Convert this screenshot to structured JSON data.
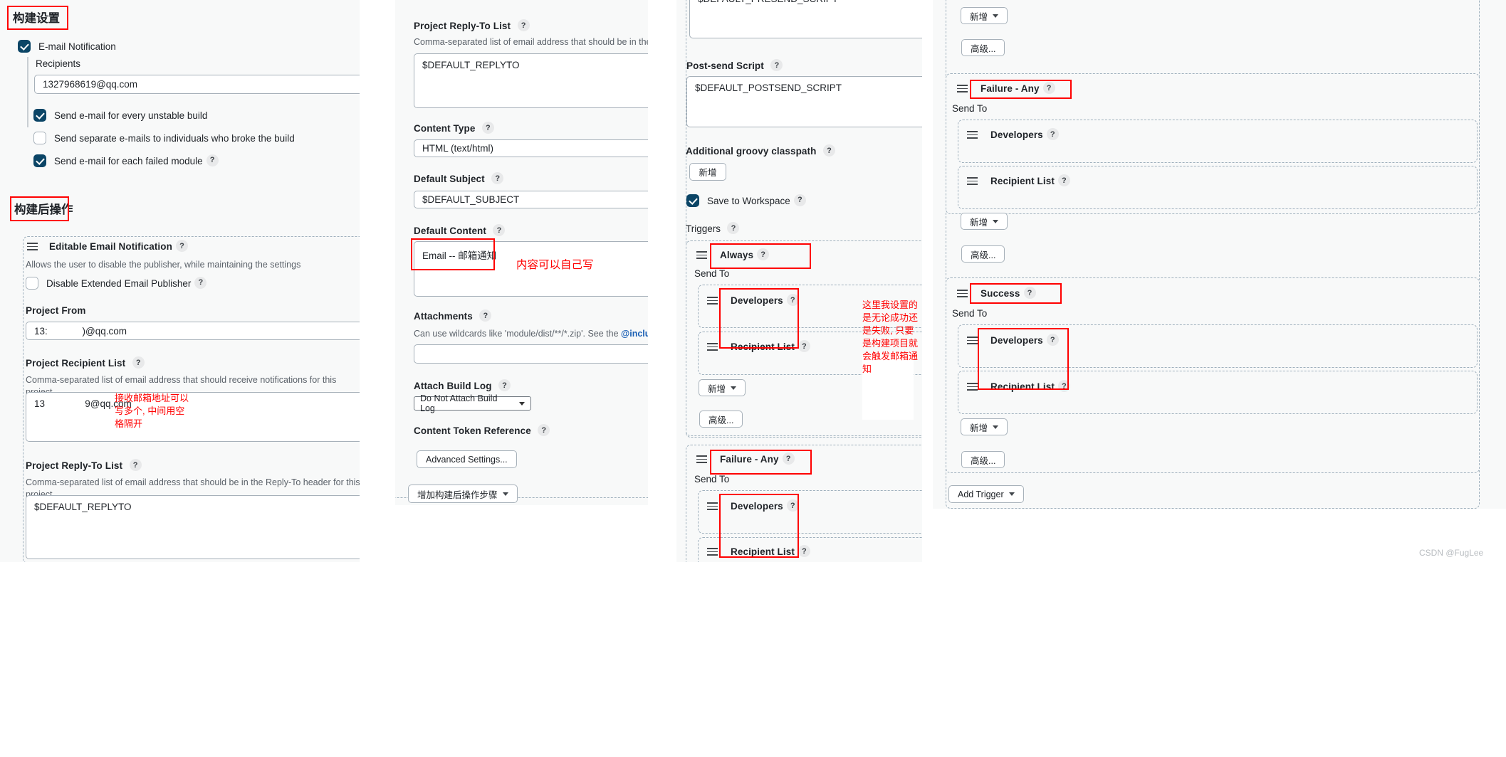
{
  "col1": {
    "section_title_build_settings": "构建设置",
    "email_notification_label": "E-mail Notification",
    "recipients_label": "Recipients",
    "recipients_value": "1327968619@qq.com",
    "checkbox_unstable": "Send e-mail for every unstable build",
    "checkbox_separate": "Send separate e-mails to individuals who broke the build",
    "checkbox_failed_module": "Send e-mail for each failed module",
    "section_title_post_build": "构建后操作",
    "editable_email_notification": "Editable Email Notification",
    "publisher_desc": "Allows the user to disable the publisher, while maintaining the settings",
    "disable_extended_publisher": "Disable Extended Email Publisher",
    "project_from_label": "Project From",
    "project_from_value": "13:             )@qq.com",
    "project_recipient_list_label": "Project Recipient List",
    "project_recipient_list_desc": "Comma-separated list of email address that should receive notifications for this project.",
    "project_recipient_list_value": "13               9@qq.com",
    "project_reply_to_label": "Project Reply-To List",
    "project_reply_to_desc": "Comma-separated list of email address that should be in the Reply-To header for this project.",
    "project_reply_to_value": "$DEFAULT_REPLYTO",
    "annotation_recipient": "接收邮箱地址可以\n写多个, 中间用空\n格隔开"
  },
  "col2": {
    "project_reply_to_label": "Project Reply-To List",
    "project_reply_to_desc": "Comma-separated list of email address that should be in the Reply-To he",
    "project_reply_to_value": "$DEFAULT_REPLYTO",
    "content_type_label": "Content Type",
    "content_type_value": "HTML (text/html)",
    "default_subject_label": "Default Subject",
    "default_subject_value": "$DEFAULT_SUBJECT",
    "default_content_label": "Default Content",
    "default_content_value": "Email -- 邮箱通知",
    "attachments_label": "Attachments",
    "attachments_desc_part1": "Can use wildcards like 'module/dist/**/*.zip'. See the ",
    "attachments_desc_link": "@includes of Ant f",
    "attachments_value": "",
    "attach_build_log_label": "Attach Build Log",
    "attach_build_log_value": "Do Not Attach Build Log",
    "content_token_reference_label": "Content Token Reference",
    "advanced_settings_button": "Advanced Settings...",
    "add_post_build_step_button": "增加构建后操作步骤",
    "annotation_content": "内容可以自己写"
  },
  "col3": {
    "presend_script_value": "$DEFAULT_PRESEND_SCRIPT",
    "post_send_script_label": "Post-send Script",
    "post_send_script_value": "$DEFAULT_POSTSEND_SCRIPT",
    "additional_groovy_classpath_label": "Additional groovy classpath",
    "add_button": "新增",
    "save_to_workspace_label": "Save to Workspace",
    "triggers_label": "Triggers",
    "trigger_always": "Always",
    "send_to_label": "Send To",
    "developers": "Developers",
    "recipient_list": "Recipient List",
    "add_dropdown": "新增",
    "advanced_button": "高级...",
    "trigger_failure_any": "Failure - Any",
    "annotation_trigger": "这里我设置的\n是无论成功还\n是失败, 只要\n是构建项目就\n会触发邮箱通\n知"
  },
  "col4": {
    "add_dropdown": "新增",
    "advanced_button": "高级...",
    "trigger_failure_any": "Failure - Any",
    "trigger_success": "Success",
    "send_to_label": "Send To",
    "developers": "Developers",
    "recipient_list": "Recipient List",
    "add_trigger_button": "Add Trigger"
  },
  "help_glyph": "?",
  "watermark": "CSDN @FugLee",
  "colors": {
    "accent_checkbox": "#0b4566",
    "annotation_red": "#ff0000",
    "panel_bg": "#f8f9f9",
    "border": "#a7b1ba",
    "link": "#1a5fb4"
  }
}
